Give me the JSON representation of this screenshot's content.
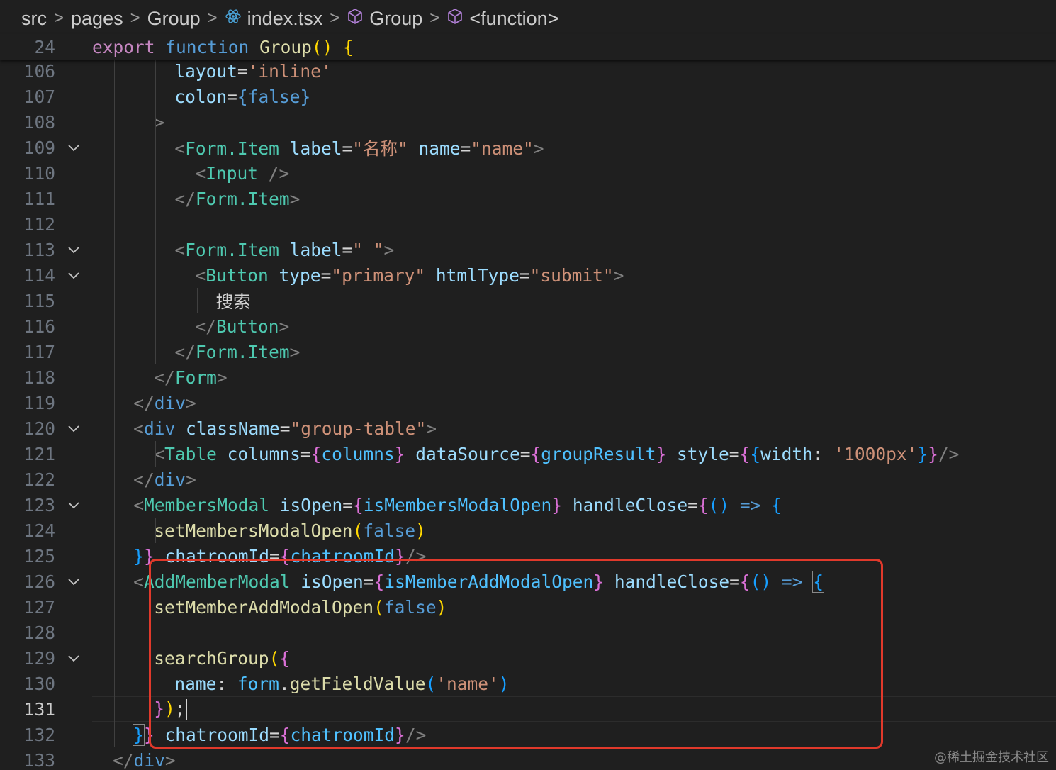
{
  "breadcrumb": [
    {
      "label": "src",
      "icon": ""
    },
    {
      "label": "pages",
      "icon": ""
    },
    {
      "label": "Group",
      "icon": ""
    },
    {
      "label": "index.tsx",
      "icon": "react-icon"
    },
    {
      "label": "Group",
      "icon": "cube-icon"
    },
    {
      "label": "<function>",
      "icon": "cube-icon"
    }
  ],
  "colors": {
    "highlight_box": "#e0392b",
    "editor_bg": "#1f1f1f"
  },
  "sticky": {
    "num": "24",
    "tokens": [
      [
        "kw",
        "export"
      ],
      [
        "txt",
        " "
      ],
      [
        "st",
        "function"
      ],
      [
        "txt",
        " "
      ],
      [
        "fn",
        "Group"
      ],
      [
        "b1",
        "()"
      ],
      [
        "txt",
        " "
      ],
      [
        "b1",
        "{"
      ]
    ]
  },
  "active_line": "131",
  "lines": [
    {
      "num": "106",
      "fold": false,
      "tokens": [
        [
          "attr",
          "layout"
        ],
        [
          "txt",
          "="
        ],
        [
          "str",
          "'inline'"
        ]
      ]
    },
    {
      "num": "107",
      "fold": false,
      "tokens": [
        [
          "attr",
          "colon"
        ],
        [
          "txt",
          "="
        ],
        [
          "st",
          "{"
        ],
        [
          "st",
          "false"
        ],
        [
          "st",
          "}"
        ]
      ]
    },
    {
      "num": "108",
      "fold": false,
      "tokens": [
        [
          "pun",
          ">"
        ]
      ]
    },
    {
      "num": "109",
      "fold": true,
      "tokens": [
        [
          "pun",
          "<"
        ],
        [
          "tag",
          "Form.Item"
        ],
        [
          "txt",
          " "
        ],
        [
          "attr",
          "label"
        ],
        [
          "txt",
          "="
        ],
        [
          "str",
          "\"名称\""
        ],
        [
          "txt",
          " "
        ],
        [
          "attr",
          "name"
        ],
        [
          "txt",
          "="
        ],
        [
          "str",
          "\"name\""
        ],
        [
          "pun",
          ">"
        ]
      ]
    },
    {
      "num": "110",
      "fold": false,
      "tokens": [
        [
          "pun",
          "<"
        ],
        [
          "tag",
          "Input"
        ],
        [
          "txt",
          " "
        ],
        [
          "pun",
          "/>"
        ]
      ]
    },
    {
      "num": "111",
      "fold": false,
      "tokens": [
        [
          "pun",
          "</"
        ],
        [
          "tag",
          "Form.Item"
        ],
        [
          "pun",
          ">"
        ]
      ]
    },
    {
      "num": "112",
      "fold": false,
      "tokens": []
    },
    {
      "num": "113",
      "fold": true,
      "tokens": [
        [
          "pun",
          "<"
        ],
        [
          "tag",
          "Form.Item"
        ],
        [
          "txt",
          " "
        ],
        [
          "attr",
          "label"
        ],
        [
          "txt",
          "="
        ],
        [
          "str",
          "\" \""
        ],
        [
          "pun",
          ">"
        ]
      ]
    },
    {
      "num": "114",
      "fold": true,
      "tokens": [
        [
          "pun",
          "<"
        ],
        [
          "tag",
          "Button"
        ],
        [
          "txt",
          " "
        ],
        [
          "attr",
          "type"
        ],
        [
          "txt",
          "="
        ],
        [
          "str",
          "\"primary\""
        ],
        [
          "txt",
          " "
        ],
        [
          "attr",
          "htmlType"
        ],
        [
          "txt",
          "="
        ],
        [
          "str",
          "\"submit\""
        ],
        [
          "pun",
          ">"
        ]
      ]
    },
    {
      "num": "115",
      "fold": false,
      "tokens": [
        [
          "txt",
          "搜索"
        ]
      ]
    },
    {
      "num": "116",
      "fold": false,
      "tokens": [
        [
          "pun",
          "</"
        ],
        [
          "tag",
          "Button"
        ],
        [
          "pun",
          ">"
        ]
      ]
    },
    {
      "num": "117",
      "fold": false,
      "tokens": [
        [
          "pun",
          "</"
        ],
        [
          "tag",
          "Form.Item"
        ],
        [
          "pun",
          ">"
        ]
      ]
    },
    {
      "num": "118",
      "fold": false,
      "tokens": [
        [
          "pun",
          "</"
        ],
        [
          "tag",
          "Form"
        ],
        [
          "pun",
          ">"
        ]
      ]
    },
    {
      "num": "119",
      "fold": false,
      "tokens": [
        [
          "pun",
          "</"
        ],
        [
          "st",
          "div"
        ],
        [
          "pun",
          ">"
        ]
      ]
    },
    {
      "num": "120",
      "fold": true,
      "tokens": [
        [
          "pun",
          "<"
        ],
        [
          "st",
          "div"
        ],
        [
          "txt",
          " "
        ],
        [
          "attr",
          "className"
        ],
        [
          "txt",
          "="
        ],
        [
          "str",
          "\"group-table\""
        ],
        [
          "pun",
          ">"
        ]
      ]
    },
    {
      "num": "121",
      "fold": false,
      "tokens": [
        [
          "pun",
          "<"
        ],
        [
          "tag",
          "Table"
        ],
        [
          "txt",
          " "
        ],
        [
          "attr",
          "columns"
        ],
        [
          "txt",
          "="
        ],
        [
          "b2",
          "{"
        ],
        [
          "var",
          "columns"
        ],
        [
          "b2",
          "}"
        ],
        [
          "txt",
          " "
        ],
        [
          "attr",
          "dataSource"
        ],
        [
          "txt",
          "="
        ],
        [
          "b2",
          "{"
        ],
        [
          "var",
          "groupResult"
        ],
        [
          "b2",
          "}"
        ],
        [
          "txt",
          " "
        ],
        [
          "attr",
          "style"
        ],
        [
          "txt",
          "="
        ],
        [
          "b2",
          "{"
        ],
        [
          "b3",
          "{"
        ],
        [
          "attr",
          "width"
        ],
        [
          "txt",
          ": "
        ],
        [
          "str",
          "'1000px'"
        ],
        [
          "b3",
          "}"
        ],
        [
          "b2",
          "}"
        ],
        [
          "pun",
          "/>"
        ]
      ]
    },
    {
      "num": "122",
      "fold": false,
      "tokens": [
        [
          "pun",
          "</"
        ],
        [
          "st",
          "div"
        ],
        [
          "pun",
          ">"
        ]
      ]
    },
    {
      "num": "123",
      "fold": true,
      "tokens": [
        [
          "pun",
          "<"
        ],
        [
          "tag",
          "MembersModal"
        ],
        [
          "txt",
          " "
        ],
        [
          "attr",
          "isOpen"
        ],
        [
          "txt",
          "="
        ],
        [
          "b2",
          "{"
        ],
        [
          "var",
          "isMembersModalOpen"
        ],
        [
          "b2",
          "}"
        ],
        [
          "txt",
          " "
        ],
        [
          "attr",
          "handleClose"
        ],
        [
          "txt",
          "="
        ],
        [
          "b2",
          "{"
        ],
        [
          "b3",
          "()"
        ],
        [
          "txt",
          " "
        ],
        [
          "st",
          "=>"
        ],
        [
          "txt",
          " "
        ],
        [
          "b3",
          "{"
        ]
      ]
    },
    {
      "num": "124",
      "fold": false,
      "tokens": [
        [
          "fn",
          "setMembersModalOpen"
        ],
        [
          "b1",
          "("
        ],
        [
          "st",
          "false"
        ],
        [
          "b1",
          ")"
        ]
      ]
    },
    {
      "num": "125",
      "fold": false,
      "tokens": [
        [
          "b3",
          "}"
        ],
        [
          "b2",
          "}"
        ],
        [
          "txt",
          " "
        ],
        [
          "attr",
          "chatroomId"
        ],
        [
          "txt",
          "="
        ],
        [
          "b2",
          "{"
        ],
        [
          "var",
          "chatroomId"
        ],
        [
          "b2",
          "}"
        ],
        [
          "pun",
          "/>"
        ]
      ]
    },
    {
      "num": "126",
      "fold": true,
      "tokens": [
        [
          "pun",
          "<"
        ],
        [
          "tag",
          "AddMemberModal"
        ],
        [
          "txt",
          " "
        ],
        [
          "attr",
          "isOpen"
        ],
        [
          "txt",
          "="
        ],
        [
          "b2",
          "{"
        ],
        [
          "var",
          "isMemberAddModalOpen"
        ],
        [
          "b2",
          "}"
        ],
        [
          "txt",
          " "
        ],
        [
          "attr",
          "handleClose"
        ],
        [
          "txt",
          "="
        ],
        [
          "b2",
          "{"
        ],
        [
          "b3",
          "()"
        ],
        [
          "txt",
          " "
        ],
        [
          "st",
          "=>"
        ],
        [
          "txt",
          " "
        ],
        [
          "b3m",
          "{"
        ]
      ]
    },
    {
      "num": "127",
      "fold": false,
      "tokens": [
        [
          "fn",
          "setMemberAddModalOpen"
        ],
        [
          "b1",
          "("
        ],
        [
          "st",
          "false"
        ],
        [
          "b1",
          ")"
        ]
      ]
    },
    {
      "num": "128",
      "fold": false,
      "tokens": []
    },
    {
      "num": "129",
      "fold": true,
      "tokens": [
        [
          "fn",
          "searchGroup"
        ],
        [
          "b1",
          "("
        ],
        [
          "b2",
          "{"
        ]
      ]
    },
    {
      "num": "130",
      "fold": false,
      "tokens": [
        [
          "attr",
          "name"
        ],
        [
          "txt",
          ": "
        ],
        [
          "var",
          "form"
        ],
        [
          "txt",
          "."
        ],
        [
          "fn",
          "getFieldValue"
        ],
        [
          "b3",
          "("
        ],
        [
          "str",
          "'name'"
        ],
        [
          "b3",
          ")"
        ]
      ]
    },
    {
      "num": "131",
      "fold": false,
      "tokens": [
        [
          "b2",
          "}"
        ],
        [
          "b1",
          ")"
        ],
        [
          "txt",
          ";"
        ],
        [
          "caret",
          ""
        ]
      ]
    },
    {
      "num": "132",
      "fold": false,
      "tokens": [
        [
          "b3m",
          "}"
        ],
        [
          "b2",
          "}"
        ],
        [
          "txt",
          " "
        ],
        [
          "attr",
          "chatroomId"
        ],
        [
          "txt",
          "="
        ],
        [
          "b2",
          "{"
        ],
        [
          "var",
          "chatroomId"
        ],
        [
          "b2",
          "}"
        ],
        [
          "pun",
          "/>"
        ]
      ]
    },
    {
      "num": "133",
      "fold": false,
      "tokens": [
        [
          "pun",
          "</"
        ],
        [
          "st",
          "div"
        ],
        [
          "pun",
          ">"
        ]
      ]
    }
  ],
  "watermark": "@稀土掘金技术社区"
}
